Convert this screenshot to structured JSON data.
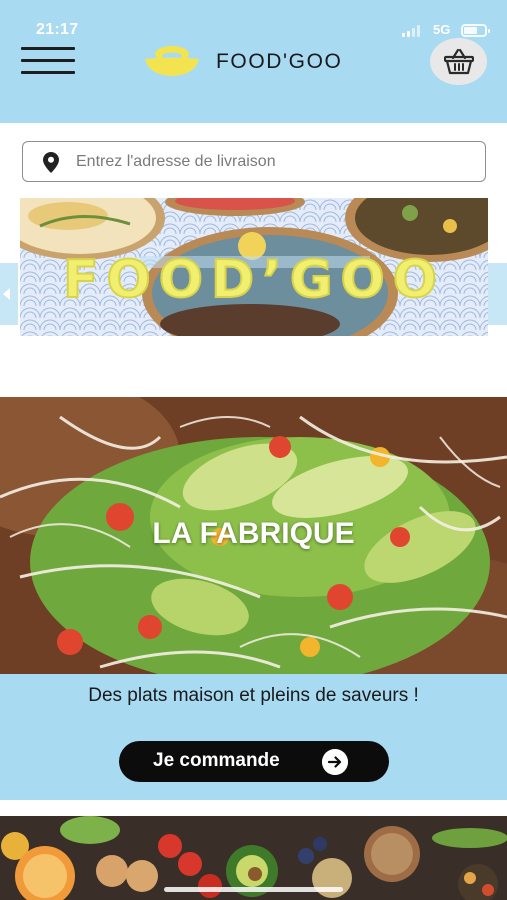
{
  "status_bar": {
    "time": "21:17",
    "network": "5G"
  },
  "header": {
    "brand_name": "FOOD'GOO",
    "brand_color": "#f3e44f",
    "background_color": "#a8dbf2",
    "menu_icon": "hamburger-menu-icon",
    "cart_icon": "basket-icon"
  },
  "address": {
    "placeholder": "Entrez l'adresse de livraison",
    "value": "",
    "icon": "location-pin-icon"
  },
  "banner": {
    "title": "FOOD’GOO",
    "title_color": "#f1ef70"
  },
  "feature": {
    "title": "LA FABRIQUE",
    "description": "Des plats maison et pleins de saveurs !",
    "button_label": "Je commande",
    "button_icon": "arrow-right-circle-icon"
  }
}
